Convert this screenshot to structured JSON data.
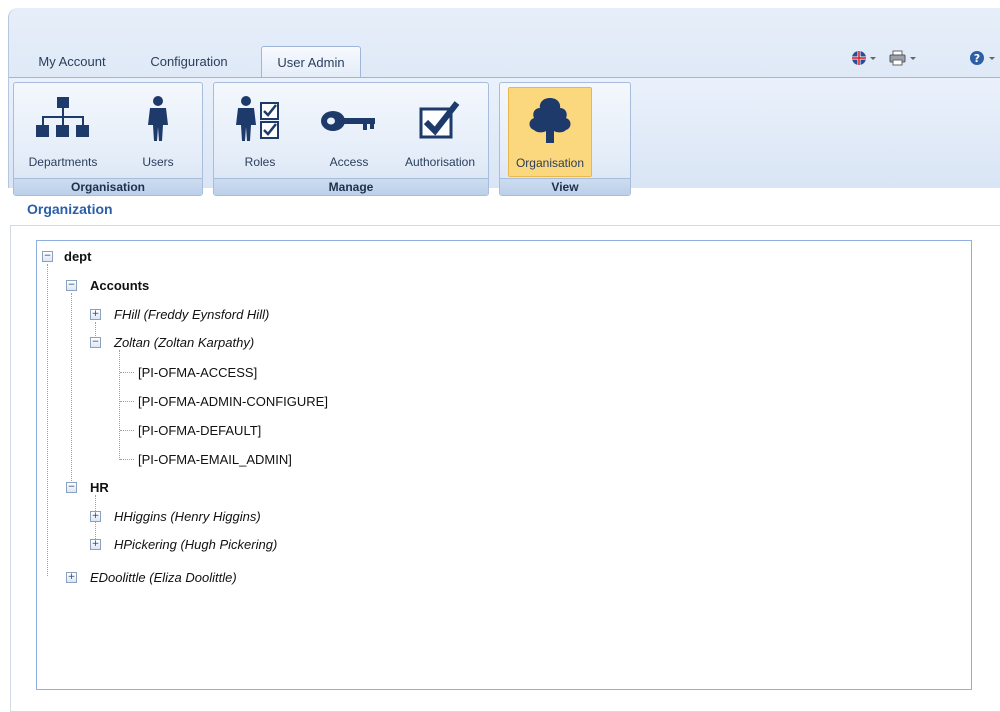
{
  "tabs": [
    {
      "label": "My Account",
      "active": false
    },
    {
      "label": "Configuration",
      "active": false
    },
    {
      "label": "User Admin",
      "active": true
    }
  ],
  "quick_access": {
    "language_icon": "uk-flag-icon",
    "print_icon": "printer-icon",
    "help_icon": "help-icon"
  },
  "ribbon": {
    "groups": [
      {
        "label": "Organisation",
        "buttons": [
          {
            "label": "Departments"
          },
          {
            "label": "Users"
          }
        ]
      },
      {
        "label": "Manage",
        "buttons": [
          {
            "label": "Roles"
          },
          {
            "label": "Access"
          },
          {
            "label": "Authorisation"
          }
        ]
      },
      {
        "label": "View",
        "buttons": [
          {
            "label": "Organisation",
            "selected": true
          }
        ]
      }
    ]
  },
  "page": {
    "title": "Organization"
  },
  "tree": {
    "root": "dept",
    "accounts": "Accounts",
    "fhill": "FHill (Freddy Eynsford Hill)",
    "zoltan": "Zoltan (Zoltan Karpathy)",
    "roles": [
      "[PI-OFMA-ACCESS]",
      "[PI-OFMA-ADMIN-CONFIGURE]",
      "[PI-OFMA-DEFAULT]",
      "[PI-OFMA-EMAIL_ADMIN]"
    ],
    "hr": "HR",
    "hhiggins": "HHiggins (Henry Higgins)",
    "hpickering": "HPickering (Hugh Pickering)",
    "edoolittle": "EDoolittle (Eliza Doolittle)"
  },
  "colors": {
    "accent_title": "#2a5ea8",
    "selected_button": "#fbd77e",
    "ribbon_bg": "#dfe9f7",
    "icon_navy": "#1d3a6b"
  }
}
